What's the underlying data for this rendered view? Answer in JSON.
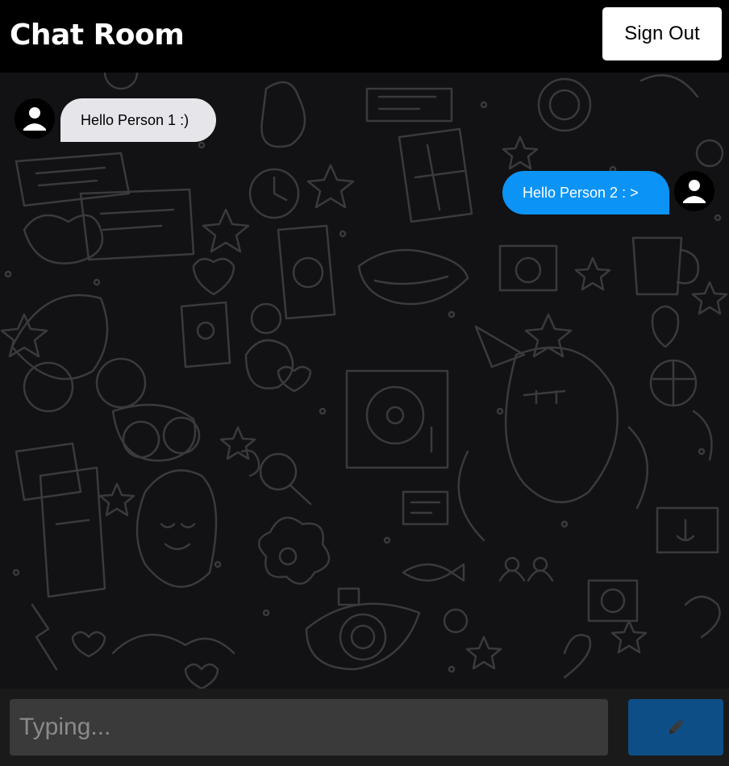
{
  "header": {
    "title": "Chat Room",
    "sign_out_label": "Sign Out"
  },
  "messages": [
    {
      "direction": "received",
      "text": "Hello Person 1 :)",
      "avatar_icon": "user-icon"
    },
    {
      "direction": "sent",
      "text": "Hello Person 2 : >",
      "avatar_icon": "user-icon"
    }
  ],
  "composer": {
    "placeholder": "Typing...",
    "send_icon": "pen-icon"
  },
  "colors": {
    "header_bg": "#000000",
    "received_bubble": "#e5e5ea",
    "sent_bubble": "#0b93f6",
    "send_button": "#0e4e86",
    "input_bg": "#3a3a3a"
  }
}
